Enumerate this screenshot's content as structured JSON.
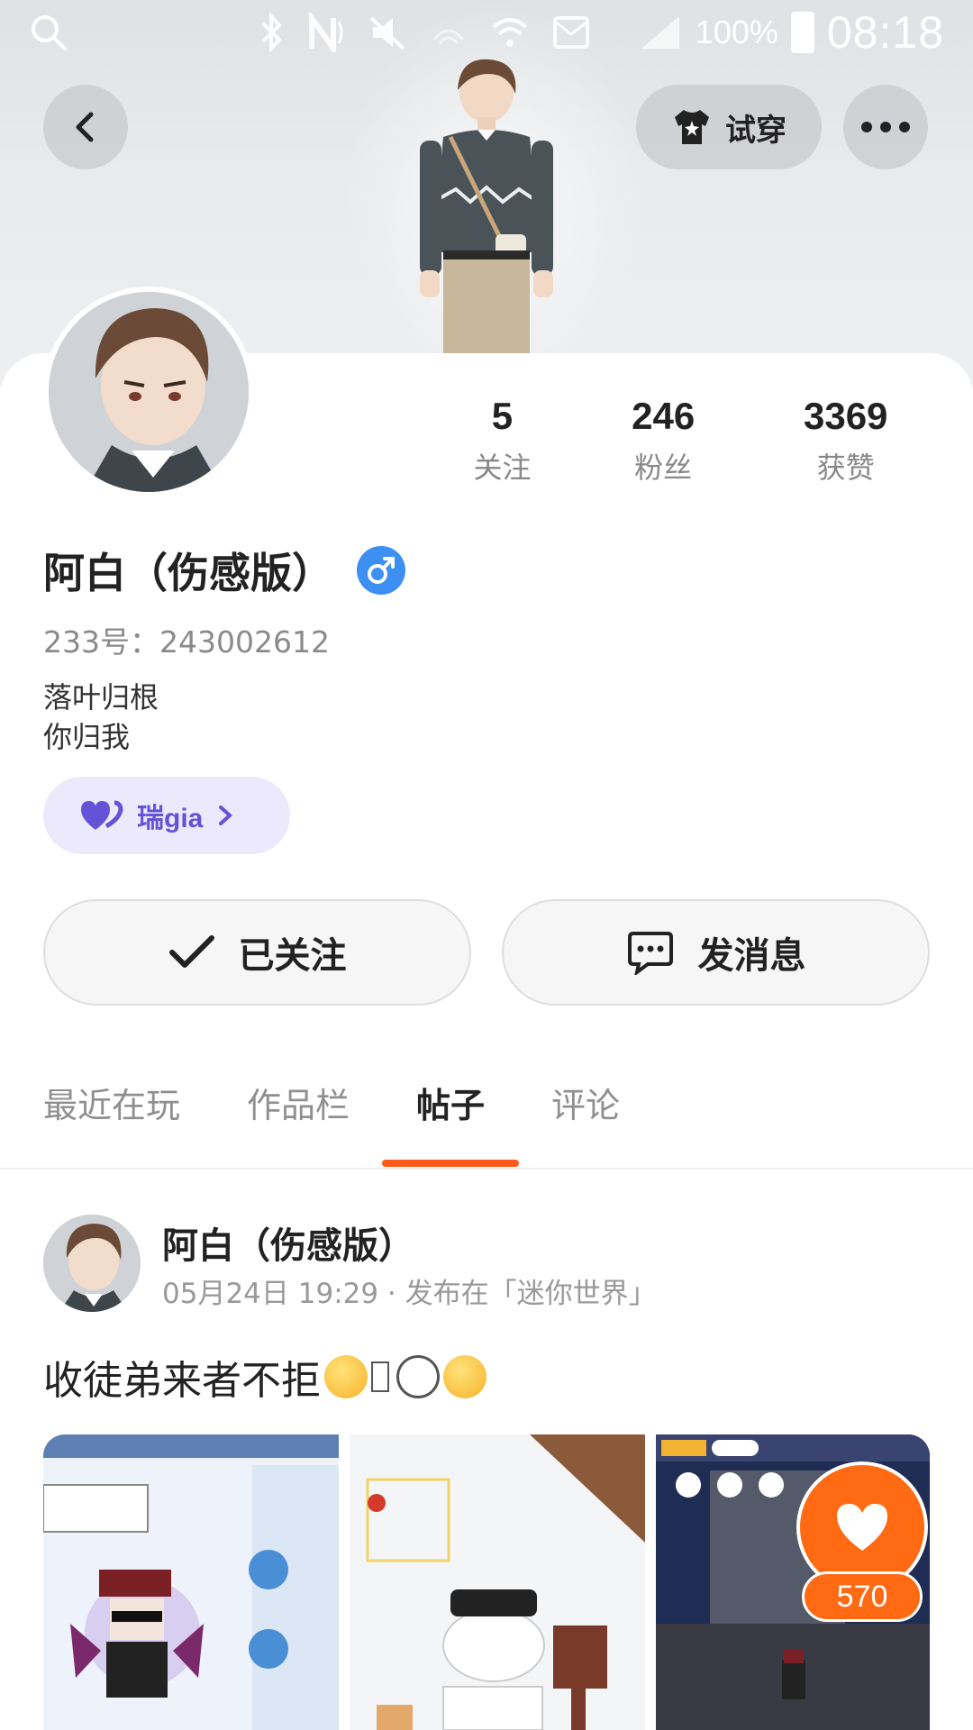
{
  "status_bar": {
    "battery_text": "100%",
    "time": "08:18"
  },
  "header": {
    "tryon_label": "试穿"
  },
  "stats": [
    {
      "value": "5",
      "label": "关注"
    },
    {
      "value": "246",
      "label": "粉丝"
    },
    {
      "value": "3369",
      "label": "获赞"
    }
  ],
  "profile": {
    "name": "阿白（伤感版）",
    "uid": "233号：243002612",
    "bio_line1": "落叶归根",
    "bio_line2": "你归我",
    "cp_name": "瑞gia"
  },
  "actions": {
    "followed_label": "已关注",
    "message_label": "发消息"
  },
  "tabs": [
    {
      "label": "最近在玩",
      "active": false
    },
    {
      "label": "作品栏",
      "active": false
    },
    {
      "label": "帖子",
      "active": true
    },
    {
      "label": "评论",
      "active": false
    }
  ],
  "post": {
    "author": "阿白（伤感版）",
    "meta": "05月24日 19:29 · 发布在「迷你世界」",
    "text": "收徒弟来者不拒"
  },
  "like": {
    "count": "570"
  },
  "colors": {
    "accent": "#ff5a1a",
    "like": "#ff6a12",
    "gender": "#3d8ff2",
    "cp_chip_bg": "#ece9fc",
    "cp_chip_text": "#6552d6"
  },
  "icons": [
    "search-icon",
    "bluetooth-icon",
    "nfc-icon",
    "mute-icon",
    "wifi-icon",
    "signal-icon",
    "battery-icon",
    "back-icon",
    "shirt-star-icon",
    "more-icon",
    "male-icon",
    "heart-icon",
    "chevron-right-icon",
    "check-icon",
    "chat-icon"
  ]
}
